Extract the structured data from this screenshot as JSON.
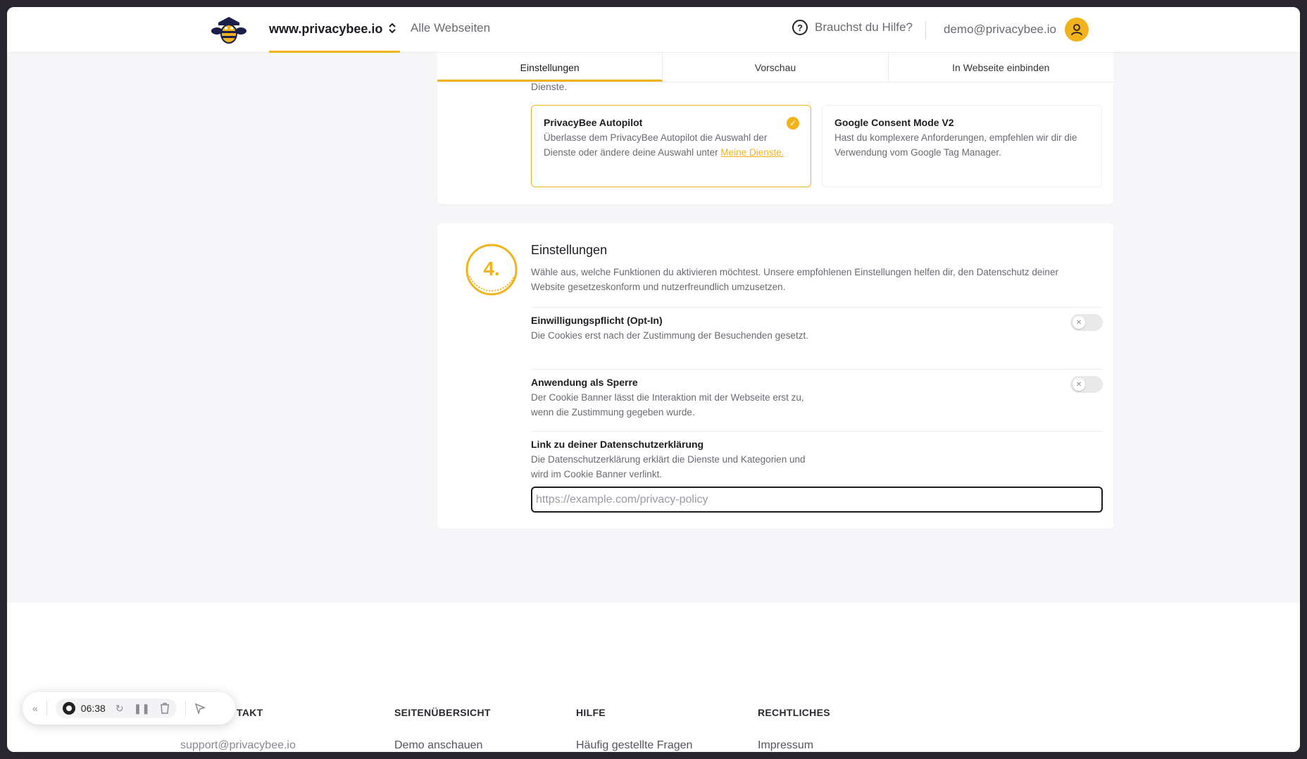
{
  "header": {
    "site_name": "www.privacybee.io",
    "all_sites": "Alle Webseiten",
    "help": "Brauchst du Hilfe?",
    "user_email": "demo@privacybee.io"
  },
  "tabs": [
    "Einstellungen",
    "Vorschau",
    "In Webseite einbinden"
  ],
  "mode_section": {
    "cut_text": "Dienste.",
    "options": [
      {
        "title": "PrivacyBee Autopilot",
        "desc": "Überlasse dem PrivacyBee Autopilot die Auswahl der Dienste oder ändere deine Auswahl unter ",
        "link": "Meine Dienste.",
        "selected": true
      },
      {
        "title": "Google Consent Mode V2",
        "desc": "Hast du komplexere Anforderungen, empfehlen wir dir die Verwendung vom Google Tag Manager.",
        "selected": false
      }
    ]
  },
  "settings": {
    "step": "4.",
    "title": "Einstellungen",
    "desc": "Wähle aus, welche Funktionen du aktivieren möchtest. Unsere empfohlenen Einstellungen helfen dir, den Datenschutz deiner Website gesetzeskonform und nutzerfreundlich umzusetzen.",
    "opt_in": {
      "title": "Einwilligungspflicht (Opt-In)",
      "desc": "Die Cookies erst nach der Zustimmung der Besuchenden gesetzt.",
      "enabled": false
    },
    "lock": {
      "title": "Anwendung als Sperre",
      "desc": "Der Cookie Banner lässt die Interaktion mit der Webseite erst zu, wenn die Zustimmung gegeben wurde.",
      "enabled": false
    },
    "privacy_link": {
      "title": "Link zu deiner Datenschutzerklärung",
      "desc": "Die Datenschutzerklärung erklärt die Dienste und Kategorien und wird im Cookie Banner verlinkt.",
      "placeholder": "https://example.com/privacy-policy",
      "value": ""
    }
  },
  "footer": {
    "columns": [
      {
        "head": "TAKT",
        "link": "support@privacybee.io"
      },
      {
        "head": "SEITENÜBERSICHT",
        "link": "Demo anschauen"
      },
      {
        "head": "HILFE",
        "link": "Häufig gestellte Fragen"
      },
      {
        "head": "RECHTLICHES",
        "link": "Impressum"
      }
    ]
  },
  "recorder": {
    "time": "06:38"
  },
  "colors": {
    "accent": "#f2b21c",
    "text": "#1c1c22",
    "muted": "#6a6a72"
  }
}
